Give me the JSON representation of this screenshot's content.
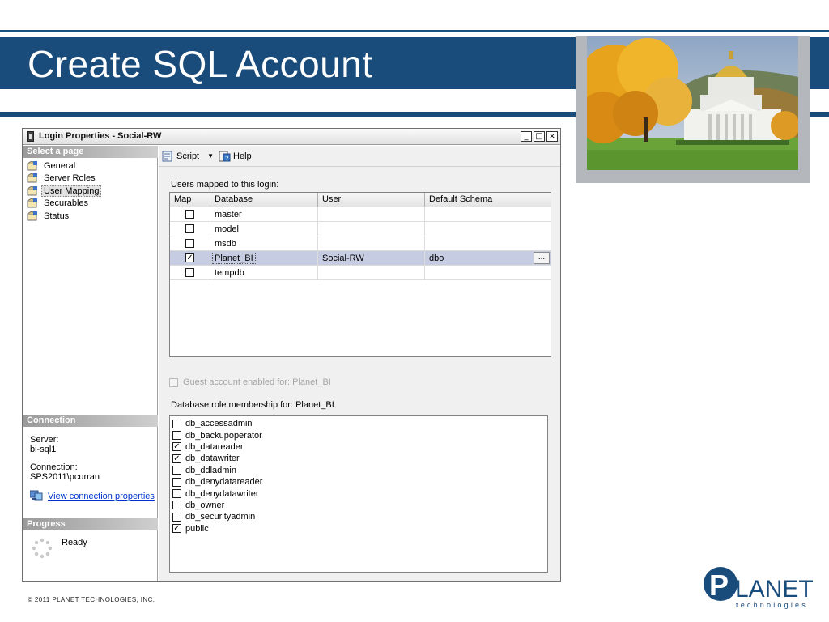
{
  "slide": {
    "title": "Create SQL Account",
    "footer": "© 2011  PLANET  TECHNOLOGIES,  INC."
  },
  "logo": {
    "main": "LANET",
    "sub": "technologies"
  },
  "dialog": {
    "title": "Login Properties - Social-RW",
    "window_buttons": [
      "_",
      "□",
      "×"
    ]
  },
  "left_pane": {
    "select_page_header": "Select a page",
    "pages": [
      {
        "label": "General",
        "icon": "page-icon",
        "selected": false
      },
      {
        "label": "Server Roles",
        "icon": "page-icon",
        "selected": false
      },
      {
        "label": "User Mapping",
        "icon": "page-icon",
        "selected": true
      },
      {
        "label": "Securables",
        "icon": "page-icon",
        "selected": false
      },
      {
        "label": "Status",
        "icon": "page-icon",
        "selected": false
      }
    ],
    "connection_header": "Connection",
    "server_label": "Server:",
    "server_value": "bi-sql1",
    "connection_label": "Connection:",
    "connection_value": "SPS2011\\pcurran",
    "view_connection_link": "View connection properties",
    "progress_header": "Progress",
    "progress_status": "Ready"
  },
  "toolbar": {
    "script_label": "Script",
    "help_label": "Help"
  },
  "users_mapped": {
    "label": "Users mapped to this login:",
    "columns": [
      "Map",
      "Database",
      "User",
      "Default Schema"
    ],
    "rows": [
      {
        "checked": false,
        "database": "master",
        "user": "",
        "schema": "",
        "selected": false
      },
      {
        "checked": false,
        "database": "model",
        "user": "",
        "schema": "",
        "selected": false
      },
      {
        "checked": false,
        "database": "msdb",
        "user": "",
        "schema": "",
        "selected": false
      },
      {
        "checked": true,
        "database": "Planet_BI",
        "user": "Social-RW",
        "schema": "dbo",
        "selected": true
      },
      {
        "checked": false,
        "database": "tempdb",
        "user": "",
        "schema": "",
        "selected": false
      }
    ],
    "ellipsis": "..."
  },
  "guest": {
    "label": "Guest account enabled for: Planet_BI",
    "checked": false,
    "enabled": false
  },
  "roles": {
    "label": "Database role membership for: Planet_BI",
    "items": [
      {
        "name": "db_accessadmin",
        "checked": false
      },
      {
        "name": "db_backupoperator",
        "checked": false
      },
      {
        "name": "db_datareader",
        "checked": true
      },
      {
        "name": "db_datawriter",
        "checked": true
      },
      {
        "name": "db_ddladmin",
        "checked": false
      },
      {
        "name": "db_denydatareader",
        "checked": false
      },
      {
        "name": "db_denydatawriter",
        "checked": false
      },
      {
        "name": "db_owner",
        "checked": false
      },
      {
        "name": "db_securityadmin",
        "checked": false
      },
      {
        "name": "public",
        "checked": true
      }
    ]
  },
  "colors": {
    "brand_blue": "#1a4c7b",
    "selected_row": "#c6cde3",
    "link": "#0033cc"
  }
}
